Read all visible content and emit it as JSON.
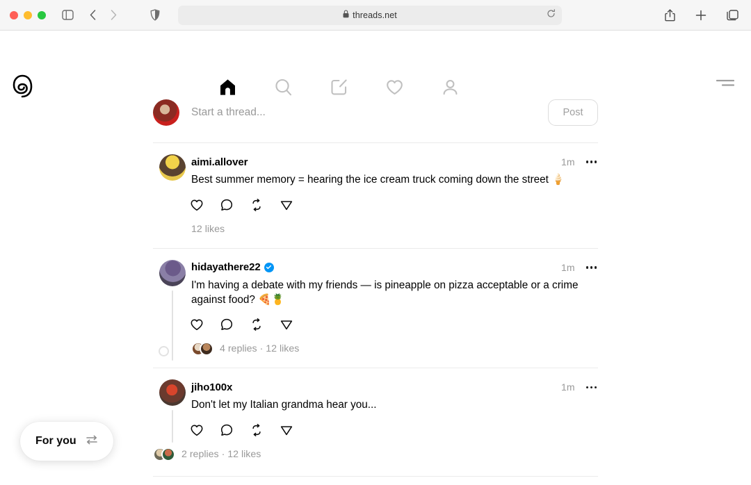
{
  "browser": {
    "url": "threads.net",
    "lock_icon": "lock-icon",
    "traffic_lights": [
      "close",
      "minimize",
      "maximize"
    ],
    "sidebar_toggle_icon": "sidebar-toggle-icon",
    "back_icon": "chevron-left-icon",
    "forward_icon": "chevron-right-icon",
    "shield_icon": "privacy-shield-icon",
    "reload_icon": "reload-icon",
    "share_icon": "share-icon",
    "new_tab_icon": "plus-icon",
    "tabs_icon": "tab-overview-icon"
  },
  "header": {
    "logo": "threads-logo",
    "nav": [
      {
        "name": "home",
        "icon": "home-icon",
        "active": true
      },
      {
        "name": "search",
        "icon": "search-icon",
        "active": false
      },
      {
        "name": "compose",
        "icon": "compose-icon",
        "active": false
      },
      {
        "name": "activity",
        "icon": "heart-icon",
        "active": false
      },
      {
        "name": "profile",
        "icon": "profile-icon",
        "active": false
      }
    ],
    "menu_icon": "hamburger-menu-icon"
  },
  "composer": {
    "avatar": "user-avatar",
    "placeholder": "Start a thread...",
    "post_label": "Post"
  },
  "posts": [
    {
      "username": "aimi.allover",
      "verified": false,
      "timestamp": "1m",
      "text": "Best summer memory = hearing the ice cream truck coming down the street 🍦",
      "likes": "12 likes",
      "replies": "",
      "meta": "12 likes",
      "has_thread_line": false,
      "reply_avatars": 0,
      "actions": [
        "like-icon",
        "comment-icon",
        "repost-icon",
        "share-icon"
      ]
    },
    {
      "username": "hidayathere22",
      "verified": true,
      "timestamp": "1m",
      "text": "I'm having a debate with my friends — is pineapple on pizza acceptable or a crime against food? 🍕🍍",
      "likes": "12 likes",
      "replies": "4 replies",
      "meta": "4 replies · 12 likes",
      "has_thread_line": true,
      "reply_avatars": 2,
      "actions": [
        "like-icon",
        "comment-icon",
        "repost-icon",
        "share-icon"
      ]
    },
    {
      "username": "jiho100x",
      "verified": false,
      "timestamp": "1m",
      "text": "Don't let my Italian grandma hear you...",
      "likes": "12 likes",
      "replies": "2 replies",
      "meta": "2 replies · 12 likes",
      "has_thread_line": true,
      "reply_avatars": 2,
      "actions": [
        "like-icon",
        "comment-icon",
        "repost-icon",
        "share-icon"
      ]
    }
  ],
  "feed_switcher": {
    "label": "For you",
    "icon": "swap-arrows-icon"
  },
  "colors": {
    "accent_verified": "#0095f6",
    "text_primary": "#000000",
    "text_muted": "#999999",
    "divider": "#ebebeb",
    "chrome_bg": "#f6f6f6"
  }
}
